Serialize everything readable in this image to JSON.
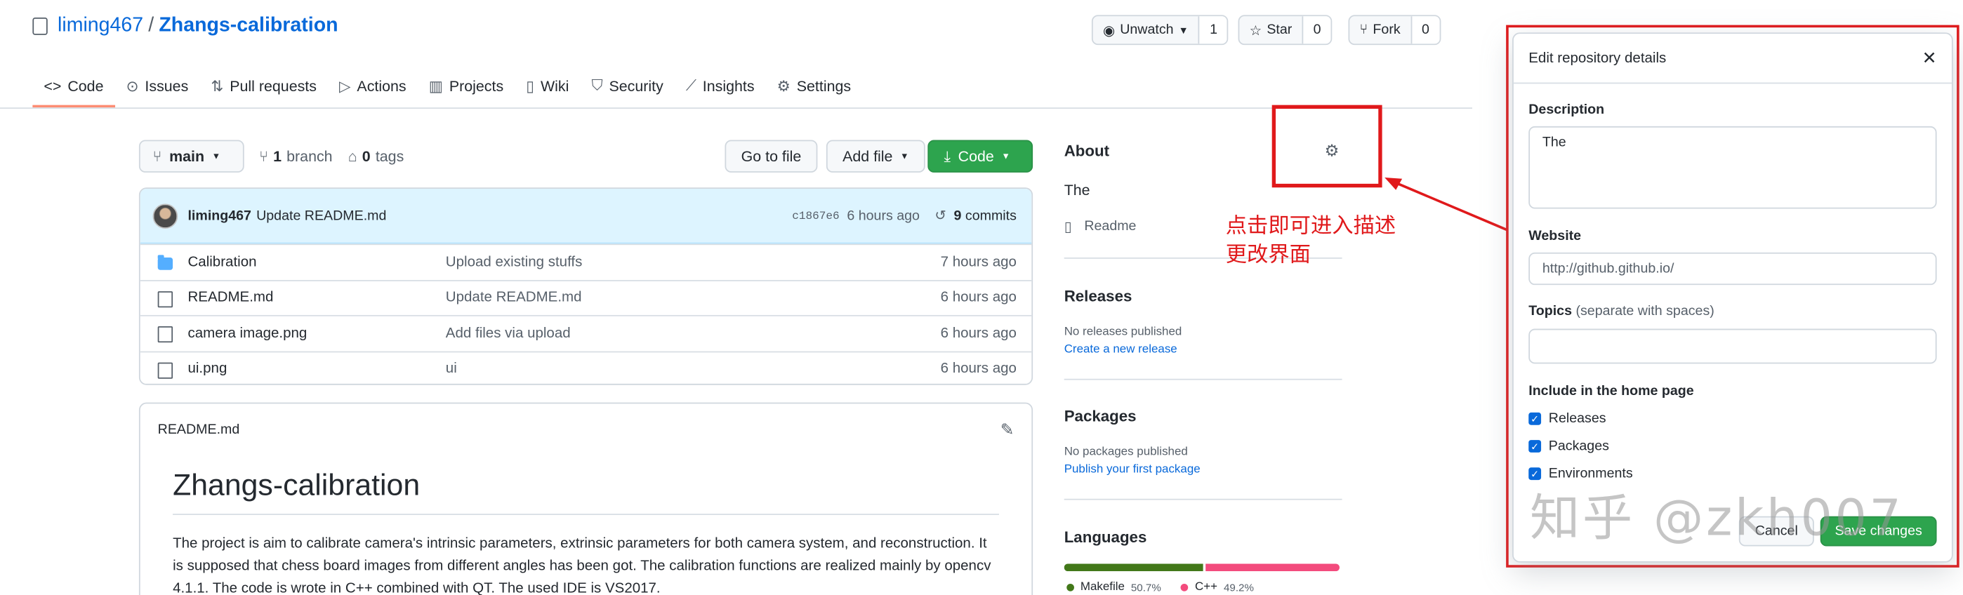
{
  "repo": {
    "owner": "liming467",
    "separator": "/",
    "name": "Zhangs-calibration"
  },
  "header_actions": {
    "watch": {
      "label": "Unwatch",
      "count": "1"
    },
    "star": {
      "label": "Star",
      "count": "0"
    },
    "fork": {
      "label": "Fork",
      "count": "0"
    }
  },
  "tabs": [
    {
      "label": "Code",
      "icon": "code-icon"
    },
    {
      "label": "Issues",
      "icon": "issue-icon"
    },
    {
      "label": "Pull requests",
      "icon": "pull-request-icon"
    },
    {
      "label": "Actions",
      "icon": "play-icon"
    },
    {
      "label": "Projects",
      "icon": "project-icon"
    },
    {
      "label": "Wiki",
      "icon": "book-icon"
    },
    {
      "label": "Security",
      "icon": "shield-icon"
    },
    {
      "label": "Insights",
      "icon": "graph-icon"
    },
    {
      "label": "Settings",
      "icon": "gear-icon"
    }
  ],
  "toolbar": {
    "branch": "main",
    "branches_count": "1",
    "branches_label": "branch",
    "tags_count": "0",
    "tags_label": "tags",
    "go_to_file": "Go to file",
    "add_file": "Add file",
    "code": "Code"
  },
  "latest_commit": {
    "author": "liming467",
    "message": "Update README.md",
    "sha": "c1867e6",
    "age": "6 hours ago",
    "commits_count": "9",
    "commits_label": "commits"
  },
  "files": [
    {
      "type": "folder",
      "name": "Calibration",
      "message": "Upload existing stuffs",
      "age": "7 hours ago"
    },
    {
      "type": "file",
      "name": "README.md",
      "message": "Update README.md",
      "age": "6 hours ago"
    },
    {
      "type": "file",
      "name": "camera image.png",
      "message": "Add files via upload",
      "age": "6 hours ago"
    },
    {
      "type": "file",
      "name": "ui.png",
      "message": "ui",
      "age": "6 hours ago"
    }
  ],
  "readme": {
    "filename": "README.md",
    "title": "Zhangs-calibration",
    "body": "The project is aim to calibrate camera's intrinsic parameters, extrinsic parameters for both camera system, and reconstruction. It is supposed that chess board images from different angles has been got. The calibration functions are realized mainly by opencv 4.1.1. The code is wrote in C++ combined with QT. The used IDE is VS2017."
  },
  "about": {
    "heading": "About",
    "description": "The",
    "readme_link": "Readme"
  },
  "releases": {
    "heading": "Releases",
    "empty": "No releases published",
    "link": "Create a new release"
  },
  "packages": {
    "heading": "Packages",
    "empty": "No packages published",
    "link": "Publish your first package"
  },
  "languages": {
    "heading": "Languages",
    "items": [
      {
        "name": "Makefile",
        "percent": "50.7%",
        "value": 50.7,
        "color": "#427819"
      },
      {
        "name": "C++",
        "percent": "49.2%",
        "value": 49.2,
        "color": "#f34b7d"
      }
    ]
  },
  "annotation": {
    "line1": "点击即可进入描述",
    "line2": "更改界面"
  },
  "modal": {
    "title": "Edit repository details",
    "description_label": "Description",
    "description_value": "The",
    "website_label": "Website",
    "website_placeholder": "http://github.github.io/",
    "topics_label": "Topics",
    "topics_hint": "(separate with spaces)",
    "include_label": "Include in the home page",
    "checkboxes": [
      {
        "label": "Releases",
        "checked": true
      },
      {
        "label": "Packages",
        "checked": true
      },
      {
        "label": "Environments",
        "checked": true
      }
    ],
    "cancel": "Cancel",
    "save": "Save changes"
  },
  "watermark": "知乎 @zkh007",
  "colors": {
    "accent_blue": "#0969da",
    "green_button": "#2da44e",
    "annotation_red": "#e0191b",
    "tab_underline": "#fd8c73"
  }
}
